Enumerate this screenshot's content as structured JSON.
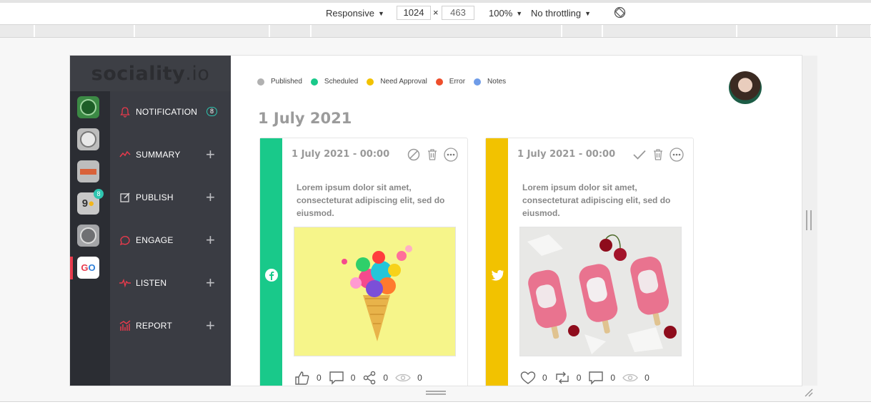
{
  "devtools": {
    "device": "Responsive",
    "width": "1024",
    "times": "×",
    "height": "463",
    "zoom": "100%",
    "throttling": "No throttling"
  },
  "app": {
    "brand_bold": "sociality",
    "brand_light": ".io"
  },
  "accounts": [
    {
      "name": "account-1",
      "color": "#3c8a45"
    },
    {
      "name": "account-2",
      "color": "#bcbcbc"
    },
    {
      "name": "account-3",
      "color": "#d9623a"
    },
    {
      "name": "account-4",
      "color": "#f2b61c",
      "badge": "8"
    },
    {
      "name": "account-5",
      "color": "#6f7073"
    },
    {
      "name": "account-6",
      "color": "#ffffff",
      "active": true
    }
  ],
  "nav": {
    "notification": {
      "label": "NOTIFICATION",
      "count": "8"
    },
    "summary": {
      "label": "SUMMARY",
      "plus": "+"
    },
    "publish": {
      "label": "PUBLISH",
      "plus": "+"
    },
    "engage": {
      "label": "ENGAGE",
      "plus": "+"
    },
    "listen": {
      "label": "LISTEN",
      "plus": "+"
    },
    "report": {
      "label": "REPORT",
      "plus": "+"
    }
  },
  "legend": [
    {
      "label": "Published",
      "color": "#b1b1b1"
    },
    {
      "label": "Scheduled",
      "color": "#19c98a"
    },
    {
      "label": "Need Approval",
      "color": "#f2c200"
    },
    {
      "label": "Error",
      "color": "#ee4e2b"
    },
    {
      "label": "Notes",
      "color": "#6f9ce8"
    }
  ],
  "date_heading": "1 July 2021",
  "posts": [
    {
      "network": "facebook",
      "strip_color": "#19c98a",
      "date": "1 July 2021 - 00:00",
      "text": "Lorem ipsum dolor sit amet, consecteturat adipiscing elit, sed do eiusmod.",
      "stats": {
        "likes": "0",
        "comments": "0",
        "shares": "0",
        "views": "0"
      }
    },
    {
      "network": "twitter",
      "strip_color": "#f2c200",
      "date": "1 July 2021 - 00:00",
      "text": "Lorem ipsum dolor sit amet, consecteturat adipiscing elit, sed do eiusmod.",
      "stats": {
        "likes": "0",
        "retweets": "0",
        "comments": "0",
        "views": "0"
      }
    }
  ]
}
